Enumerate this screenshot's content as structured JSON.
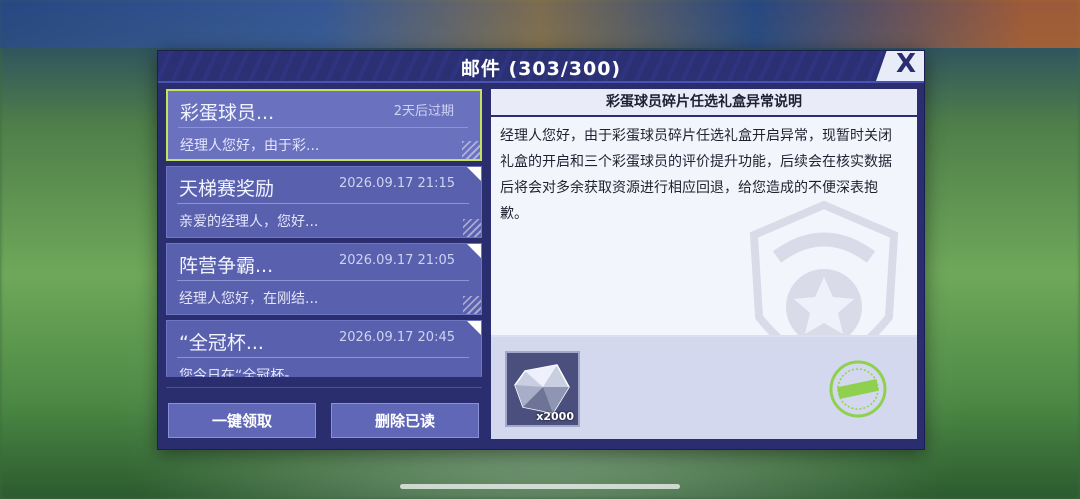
{
  "dialog": {
    "title": "邮件 (303/300)",
    "close_label": "X"
  },
  "mails": [
    {
      "subject": "彩蛋球员...",
      "time": "2天后过期",
      "preview": "经理人您好，由于彩..."
    },
    {
      "subject": "天梯赛奖励",
      "time": "2026.09.17 21:15",
      "preview": "亲爱的经理人，您好..."
    },
    {
      "subject": "阵营争霸...",
      "time": "2026.09.17 21:05",
      "preview": "经理人您好，在刚结..."
    },
    {
      "subject": "“全冠杯...",
      "time": "2026.09.17 20:45",
      "preview": "您今日在“全冠杯-"
    }
  ],
  "buttons": {
    "claim_all": "一键领取",
    "delete_read": "删除已读"
  },
  "detail": {
    "heading": "彩蛋球员碎片任选礼盒异常说明",
    "body": "经理人您好，由于彩蛋球员碎片任选礼盒开启异常，现暂时关闭礼盒的开启和三个彩蛋球员的评价提升功能，后续会在核实数据后将会对多余获取资源进行相应回退，给您造成的不便深表抱歉。",
    "attachment": {
      "icon": "diamond-icon",
      "quantity": "x2000"
    },
    "stamp_icon": "claimed-stamp-icon"
  },
  "colors": {
    "panel": "#2a2e6e",
    "mail_item": "#5960ad",
    "selected_border": "#c4e35a",
    "stamp": "#8fd14f"
  }
}
